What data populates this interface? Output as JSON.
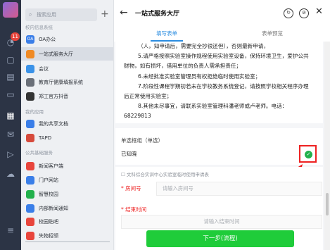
{
  "sidebar": {
    "search_placeholder": "搜索应用",
    "badge": "11",
    "sections": [
      {
        "title": "校内信息系统",
        "items": [
          {
            "label": "OA办公",
            "icon_text": "OA",
            "color": "#3a7ee8"
          },
          {
            "label": "一站式服务大厅",
            "icon_text": "",
            "color": "#f08a24"
          },
          {
            "label": "会议",
            "icon_text": "",
            "color": "#3a92e8"
          },
          {
            "label": "教育厅健康填报系统",
            "icon_text": "",
            "color": "#6a6f78"
          },
          {
            "label": "郑工官方抖音",
            "icon_text": "",
            "color": "#333333"
          }
        ]
      },
      {
        "title": "我的应用",
        "items": [
          {
            "label": "我的共享文档",
            "icon_text": "",
            "color": "#3a7ee8"
          },
          {
            "label": "TAPD",
            "icon_text": "",
            "color": "#d64a3c"
          }
        ]
      },
      {
        "title": "公共基础服务",
        "items": [
          {
            "label": "新闻客户端",
            "icon_text": "",
            "color": "#e8453c"
          },
          {
            "label": "门户网站",
            "icon_text": "",
            "color": "#3a7ee8"
          },
          {
            "label": "智慧校园",
            "icon_text": "",
            "color": "#22b14c"
          },
          {
            "label": "内部新闻通知",
            "icon_text": "",
            "color": "#3a7ee8"
          },
          {
            "label": "校园贴吧",
            "icon_text": "",
            "color": "#e8453c"
          },
          {
            "label": "失物招领",
            "icon_text": "",
            "color": "#e8453c"
          }
        ]
      }
    ]
  },
  "header": {
    "title": "一站式服务大厅"
  },
  "tabs": [
    {
      "label": "填写表单"
    },
    {
      "label": "表单预览"
    }
  ],
  "rules": [
    "（人，知申请后，需要完全抄很还但），否则最新申请，",
    "5.请严格按照实验室操作规程使用实验室设备，保持环境卫生，爱护公共财物，如有损坏，借用单位的负责人需承担责任；",
    "6.未经批准实验室管理员有权拒绝临时使用实验室；",
    "7.阶段性课程学期初若未在学校教务系统登记，请按照学校相关程序办理后正常使用实验室；",
    "8.其他未尽事宜，请联系实验室管理科潘老师或卢老师。电话：68229813"
  ],
  "single_select": {
    "label": "单选框组（单选）",
    "value": "已知晓",
    "checked": true
  },
  "form_note": "文科综合实训中心实验室临时使用申请表",
  "fields": {
    "room_label": "房间号",
    "room_placeholder": "请输入房间号",
    "end_label": "结束时间",
    "end_placeholder": "请输入结束时间"
  },
  "next_button": "下一步(流程)",
  "colors": {
    "accent": "#2b8de0",
    "confirm": "#1fcc3a",
    "highlight": "#ee2222"
  }
}
